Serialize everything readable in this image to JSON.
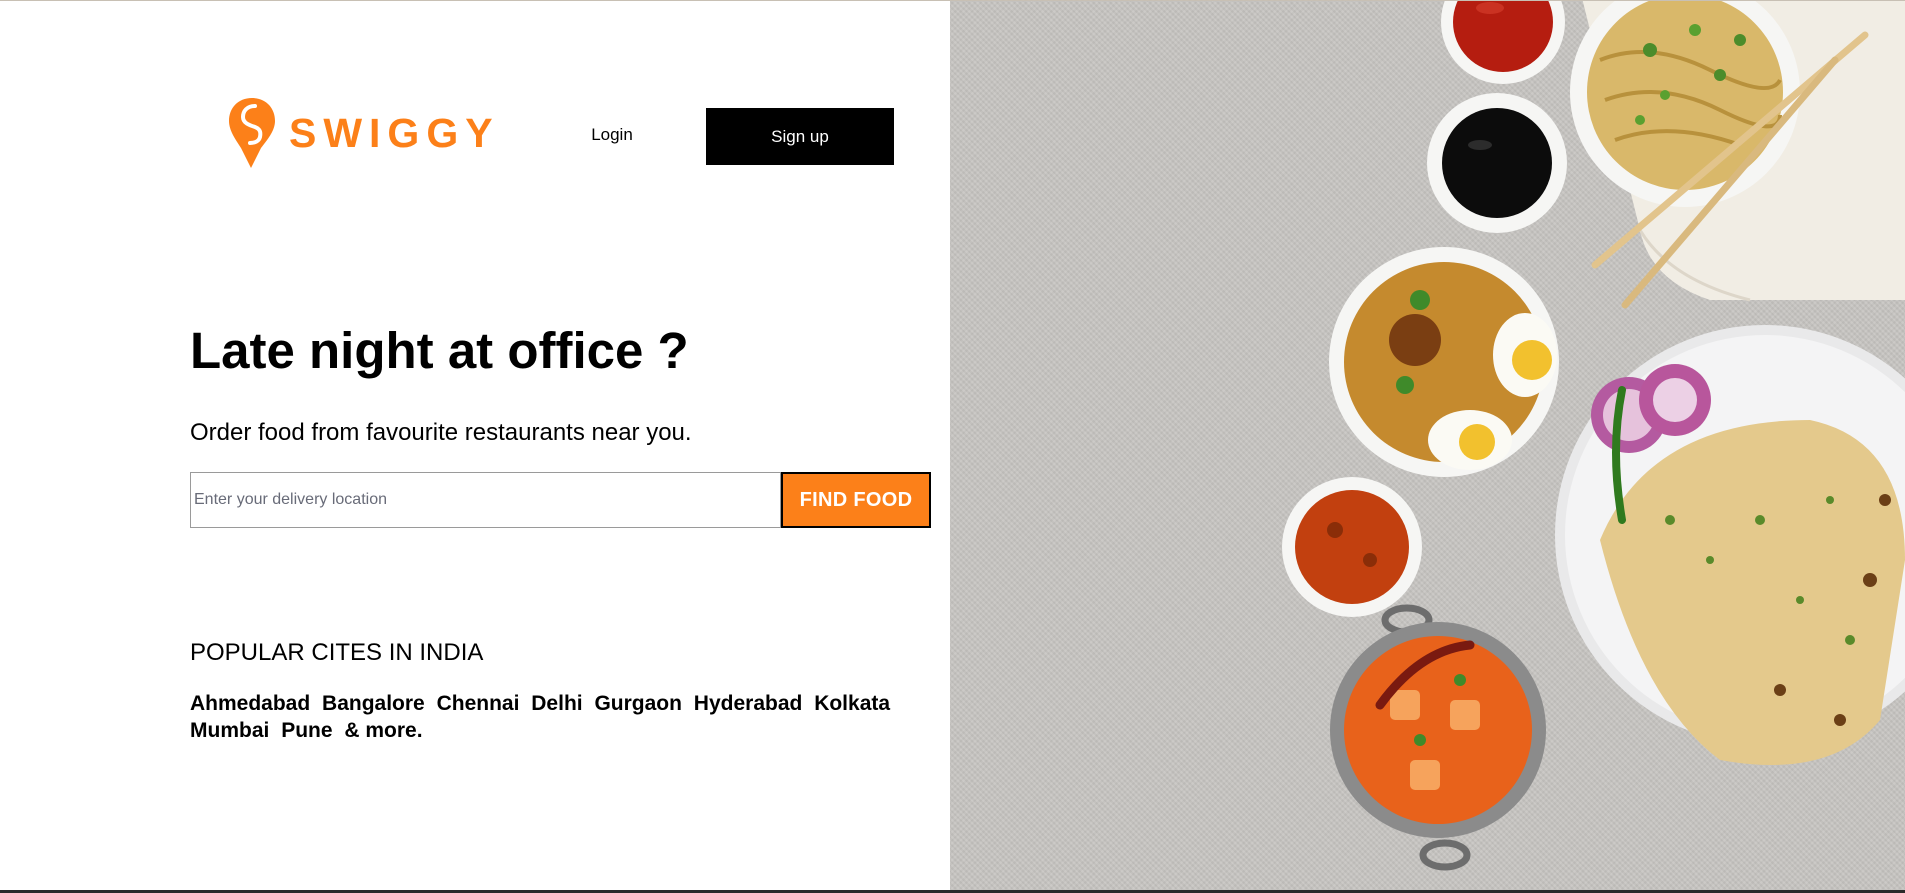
{
  "brand": {
    "name": "SWIGGY",
    "color": "#fc8019"
  },
  "nav": {
    "login_label": "Login",
    "signup_label": "Sign up"
  },
  "hero": {
    "headline": "Late night at office ?",
    "subtext": "Order food from favourite restaurants near you."
  },
  "search": {
    "value": "",
    "placeholder": "Enter your delivery location",
    "button_label": "FIND FOOD"
  },
  "popular": {
    "title": "POPULAR CITES IN INDIA",
    "cities": [
      "Ahmedabad",
      "Bangalore",
      "Chennai",
      "Delhi",
      "Gurgaon",
      "Hyderabad",
      "Kolkata",
      "Mumbai",
      "Pune",
      "& more."
    ]
  },
  "image": {
    "subject": "food-spread",
    "icon_names": [
      "swiggy-logo-icon"
    ]
  }
}
